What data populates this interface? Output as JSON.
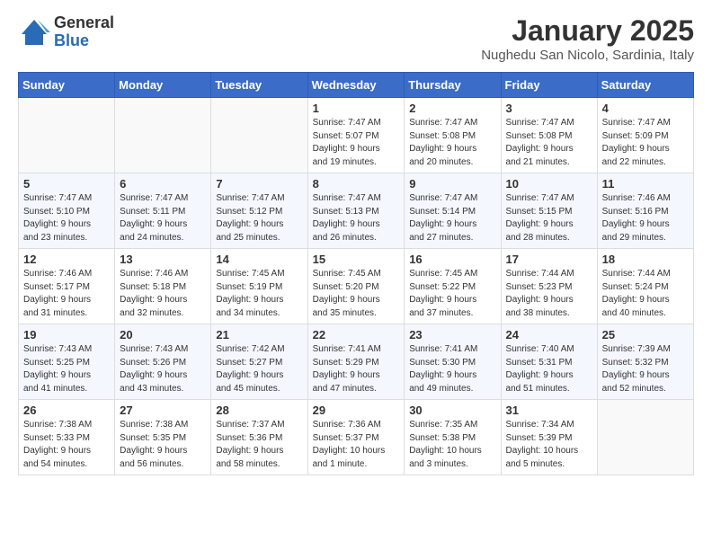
{
  "logo": {
    "general": "General",
    "blue": "Blue"
  },
  "title": "January 2025",
  "subtitle": "Nughedu San Nicolo, Sardinia, Italy",
  "weekdays": [
    "Sunday",
    "Monday",
    "Tuesday",
    "Wednesday",
    "Thursday",
    "Friday",
    "Saturday"
  ],
  "weeks": [
    [
      {
        "day": "",
        "info": ""
      },
      {
        "day": "",
        "info": ""
      },
      {
        "day": "",
        "info": ""
      },
      {
        "day": "1",
        "info": "Sunrise: 7:47 AM\nSunset: 5:07 PM\nDaylight: 9 hours\nand 19 minutes."
      },
      {
        "day": "2",
        "info": "Sunrise: 7:47 AM\nSunset: 5:08 PM\nDaylight: 9 hours\nand 20 minutes."
      },
      {
        "day": "3",
        "info": "Sunrise: 7:47 AM\nSunset: 5:08 PM\nDaylight: 9 hours\nand 21 minutes."
      },
      {
        "day": "4",
        "info": "Sunrise: 7:47 AM\nSunset: 5:09 PM\nDaylight: 9 hours\nand 22 minutes."
      }
    ],
    [
      {
        "day": "5",
        "info": "Sunrise: 7:47 AM\nSunset: 5:10 PM\nDaylight: 9 hours\nand 23 minutes."
      },
      {
        "day": "6",
        "info": "Sunrise: 7:47 AM\nSunset: 5:11 PM\nDaylight: 9 hours\nand 24 minutes."
      },
      {
        "day": "7",
        "info": "Sunrise: 7:47 AM\nSunset: 5:12 PM\nDaylight: 9 hours\nand 25 minutes."
      },
      {
        "day": "8",
        "info": "Sunrise: 7:47 AM\nSunset: 5:13 PM\nDaylight: 9 hours\nand 26 minutes."
      },
      {
        "day": "9",
        "info": "Sunrise: 7:47 AM\nSunset: 5:14 PM\nDaylight: 9 hours\nand 27 minutes."
      },
      {
        "day": "10",
        "info": "Sunrise: 7:47 AM\nSunset: 5:15 PM\nDaylight: 9 hours\nand 28 minutes."
      },
      {
        "day": "11",
        "info": "Sunrise: 7:46 AM\nSunset: 5:16 PM\nDaylight: 9 hours\nand 29 minutes."
      }
    ],
    [
      {
        "day": "12",
        "info": "Sunrise: 7:46 AM\nSunset: 5:17 PM\nDaylight: 9 hours\nand 31 minutes."
      },
      {
        "day": "13",
        "info": "Sunrise: 7:46 AM\nSunset: 5:18 PM\nDaylight: 9 hours\nand 32 minutes."
      },
      {
        "day": "14",
        "info": "Sunrise: 7:45 AM\nSunset: 5:19 PM\nDaylight: 9 hours\nand 34 minutes."
      },
      {
        "day": "15",
        "info": "Sunrise: 7:45 AM\nSunset: 5:20 PM\nDaylight: 9 hours\nand 35 minutes."
      },
      {
        "day": "16",
        "info": "Sunrise: 7:45 AM\nSunset: 5:22 PM\nDaylight: 9 hours\nand 37 minutes."
      },
      {
        "day": "17",
        "info": "Sunrise: 7:44 AM\nSunset: 5:23 PM\nDaylight: 9 hours\nand 38 minutes."
      },
      {
        "day": "18",
        "info": "Sunrise: 7:44 AM\nSunset: 5:24 PM\nDaylight: 9 hours\nand 40 minutes."
      }
    ],
    [
      {
        "day": "19",
        "info": "Sunrise: 7:43 AM\nSunset: 5:25 PM\nDaylight: 9 hours\nand 41 minutes."
      },
      {
        "day": "20",
        "info": "Sunrise: 7:43 AM\nSunset: 5:26 PM\nDaylight: 9 hours\nand 43 minutes."
      },
      {
        "day": "21",
        "info": "Sunrise: 7:42 AM\nSunset: 5:27 PM\nDaylight: 9 hours\nand 45 minutes."
      },
      {
        "day": "22",
        "info": "Sunrise: 7:41 AM\nSunset: 5:29 PM\nDaylight: 9 hours\nand 47 minutes."
      },
      {
        "day": "23",
        "info": "Sunrise: 7:41 AM\nSunset: 5:30 PM\nDaylight: 9 hours\nand 49 minutes."
      },
      {
        "day": "24",
        "info": "Sunrise: 7:40 AM\nSunset: 5:31 PM\nDaylight: 9 hours\nand 51 minutes."
      },
      {
        "day": "25",
        "info": "Sunrise: 7:39 AM\nSunset: 5:32 PM\nDaylight: 9 hours\nand 52 minutes."
      }
    ],
    [
      {
        "day": "26",
        "info": "Sunrise: 7:38 AM\nSunset: 5:33 PM\nDaylight: 9 hours\nand 54 minutes."
      },
      {
        "day": "27",
        "info": "Sunrise: 7:38 AM\nSunset: 5:35 PM\nDaylight: 9 hours\nand 56 minutes."
      },
      {
        "day": "28",
        "info": "Sunrise: 7:37 AM\nSunset: 5:36 PM\nDaylight: 9 hours\nand 58 minutes."
      },
      {
        "day": "29",
        "info": "Sunrise: 7:36 AM\nSunset: 5:37 PM\nDaylight: 10 hours\nand 1 minute."
      },
      {
        "day": "30",
        "info": "Sunrise: 7:35 AM\nSunset: 5:38 PM\nDaylight: 10 hours\nand 3 minutes."
      },
      {
        "day": "31",
        "info": "Sunrise: 7:34 AM\nSunset: 5:39 PM\nDaylight: 10 hours\nand 5 minutes."
      },
      {
        "day": "",
        "info": ""
      }
    ]
  ]
}
